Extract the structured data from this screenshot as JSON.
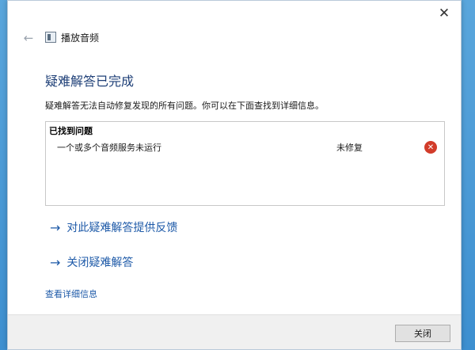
{
  "window": {
    "close_glyph": "✕",
    "title": "播放音频",
    "back_glyph": "←"
  },
  "main": {
    "heading": "疑难解答已完成",
    "description": "疑难解答无法自动修复发现的所有问题。你可以在下面查找到详细信息。",
    "problems": {
      "header": "已找到问题",
      "items": [
        {
          "name": "一个或多个音频服务未运行",
          "status": "未修复",
          "icon": "error-icon"
        }
      ]
    },
    "links": [
      {
        "arrow": "→",
        "label": "对此疑难解答提供反馈"
      },
      {
        "arrow": "→",
        "label": "关闭疑难解答"
      }
    ],
    "details_link": "查看详细信息"
  },
  "footer": {
    "close_button": "关闭"
  },
  "colors": {
    "heading": "#1e3f77",
    "link": "#1e5aa8",
    "error": "#d23c2a"
  }
}
